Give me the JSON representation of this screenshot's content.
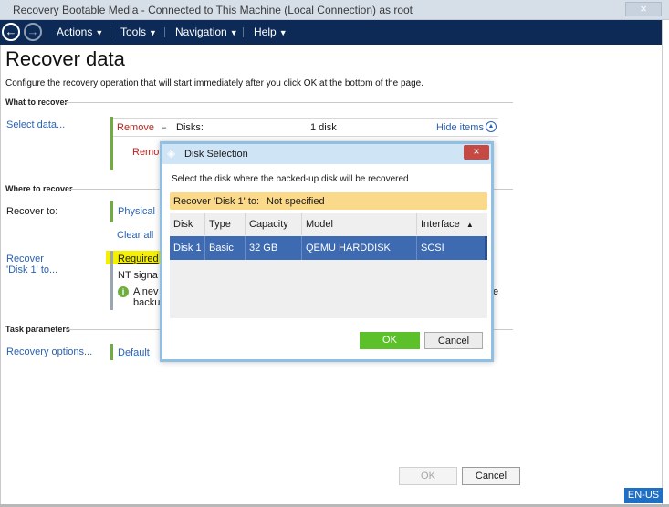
{
  "window": {
    "title": "Recovery Bootable Media - Connected to This Machine (Local Connection) as root",
    "close_glyph": "×"
  },
  "nav": {
    "back_glyph": "←",
    "forward_glyph": "→",
    "menus": [
      {
        "label": "Actions"
      },
      {
        "label": "Tools"
      },
      {
        "label": "Navigation"
      },
      {
        "label": "Help"
      }
    ]
  },
  "page": {
    "title": "Recover data",
    "subtitle": "Configure the recovery operation that will start immediately after you click OK at the bottom of the page."
  },
  "sections": {
    "what": {
      "header": "What to recover",
      "select_link": "Select data...",
      "remove1": "Remove",
      "disks_label": "Disks:",
      "disks_count": "1 disk",
      "hide_items": "Hide items",
      "remove2": "Remo"
    },
    "where": {
      "header": "Where to recover",
      "recover_to_label": "Recover to:",
      "physical": "Physical",
      "clear_all": "Clear all",
      "recover_disk_link_1": "Recover",
      "recover_disk_link_2": "'Disk 1' to...",
      "required": "Required",
      "nt_signature": "NT signa",
      "info_1": "A nev",
      "info_2": "backu",
      "trailing_e": "e"
    },
    "task": {
      "header": "Task parameters",
      "recovery_options_link": "Recovery options...",
      "default_link": "Default"
    }
  },
  "dialog": {
    "title": "Disk Selection",
    "close_glyph": "×",
    "instruction": "Select the disk where the backed-up disk will be recovered",
    "banner_label": "Recover 'Disk 1' to:",
    "banner_value": "Not specified",
    "columns": [
      "Disk",
      "Type",
      "Capacity",
      "Model",
      "Interface"
    ],
    "sort_glyph": "▲",
    "rows": [
      {
        "disk": "Disk 1",
        "type": "Basic",
        "capacity": "32 GB",
        "model": "QEMU HARDDISK",
        "interface": "SCSI"
      }
    ],
    "ok_label": "OK",
    "cancel_label": "Cancel"
  },
  "footer": {
    "ok_label": "OK",
    "cancel_label": "Cancel",
    "language": "EN-US"
  },
  "colors": {
    "nav_bg": "#0c2a55",
    "accent_green": "#6fae3e",
    "ok_green": "#5bc02a",
    "selection_blue": "#3d6ab0",
    "banner_yellow": "#fbd98a",
    "highlight_yellow": "#f4f000",
    "link_blue": "#2a62b4",
    "close_red": "#c64a44"
  },
  "icons": {
    "disk": "disk-icon",
    "collapse": "collapse-circle-icon",
    "info": "info-icon",
    "dialog": "stack-icon"
  }
}
